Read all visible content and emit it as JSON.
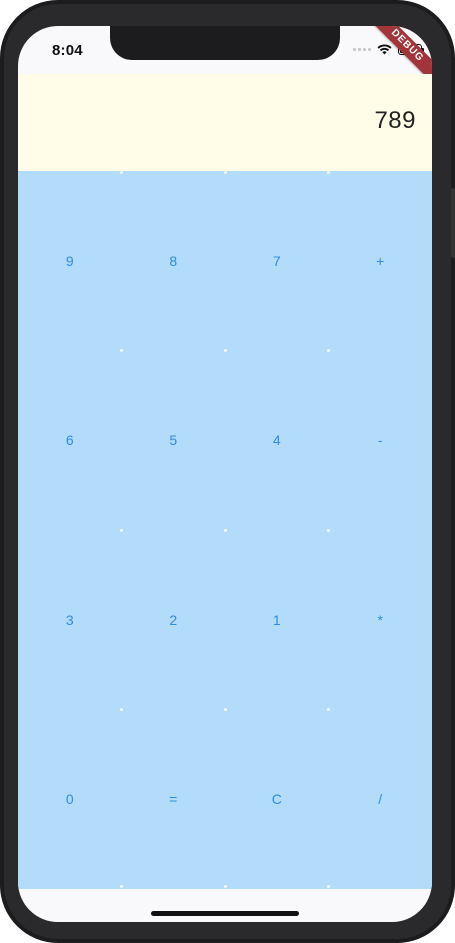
{
  "status_bar": {
    "time": "8:04"
  },
  "debug_banner": {
    "label": "DEBUG"
  },
  "display": {
    "value": "789"
  },
  "keypad": {
    "keys": [
      {
        "label": "9",
        "name": "key-9"
      },
      {
        "label": "8",
        "name": "key-8"
      },
      {
        "label": "7",
        "name": "key-7"
      },
      {
        "label": "+",
        "name": "key-plus"
      },
      {
        "label": "6",
        "name": "key-6"
      },
      {
        "label": "5",
        "name": "key-5"
      },
      {
        "label": "4",
        "name": "key-4"
      },
      {
        "label": "-",
        "name": "key-minus"
      },
      {
        "label": "3",
        "name": "key-3"
      },
      {
        "label": "2",
        "name": "key-2"
      },
      {
        "label": "1",
        "name": "key-1"
      },
      {
        "label": "*",
        "name": "key-multiply"
      },
      {
        "label": "0",
        "name": "key-0"
      },
      {
        "label": "=",
        "name": "key-equals"
      },
      {
        "label": "C",
        "name": "key-clear"
      },
      {
        "label": "/",
        "name": "key-divide"
      }
    ]
  },
  "colors": {
    "display_background": "#fffde7",
    "keypad_background": "#b3dbfa",
    "key_text": "#2f8de4",
    "debug_banner": "#a3343a"
  }
}
